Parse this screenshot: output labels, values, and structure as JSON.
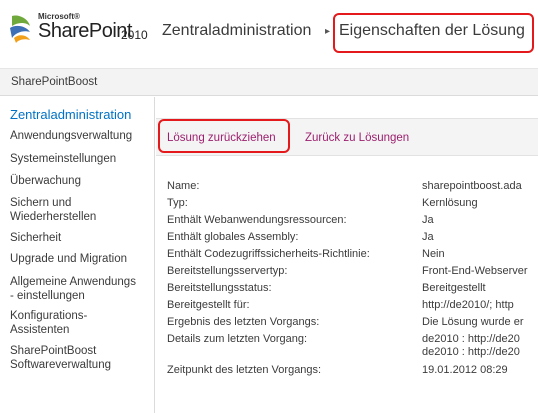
{
  "logo": {
    "microsoft": "Microsoft®",
    "product": "SharePoint",
    "version": "2010"
  },
  "breadcrumb": {
    "root": "Zentraladministration",
    "separator": "▸",
    "current": "Eigenschaften der Lösung"
  },
  "topnav": {
    "site": "SharePointBoost"
  },
  "leftnav": {
    "title": "Zentraladministration",
    "items": [
      "Anwendungsverwaltung",
      "Systemeinstellungen",
      "Überwachung",
      "Sichern und\nWiederherstellen",
      "Sicherheit",
      "Upgrade und Migration",
      "Allgemeine Anwendungs\n- einstellungen",
      "Konfigurations-\nAssistenten",
      "SharePointBoost\nSoftwareverwaltung"
    ]
  },
  "toolbar": {
    "withdraw": "Lösung zurückziehen",
    "back": "Zurück zu Lösungen"
  },
  "properties": [
    {
      "label": "Name:",
      "value": "sharepointboost.ada"
    },
    {
      "label": "Typ:",
      "value": "Kernlösung"
    },
    {
      "label": "Enthält Webanwendungsressourcen:",
      "value": "Ja"
    },
    {
      "label": "Enthält globales Assembly:",
      "value": "Ja"
    },
    {
      "label": "Enthält Codezugriffssicherheits-Richtlinie:",
      "value": "Nein"
    },
    {
      "label": "Bereitstellungsservertyp:",
      "value": "Front-End-Webserver"
    },
    {
      "label": "Bereitstellungsstatus:",
      "value": "Bereitgestellt"
    },
    {
      "label": "Bereitgestellt für:",
      "value": "http://de2010/; http"
    },
    {
      "label": "Ergebnis des letzten Vorgangs:",
      "value": "Die Lösung wurde er"
    },
    {
      "label": "Details zum letzten Vorgang:",
      "value": "de2010 : http://de20"
    },
    {
      "label": "",
      "value": "de2010 : http://de20"
    },
    {
      "label": "Zeitpunkt des letzten Vorgangs:",
      "value": "19.01.2012 08:29"
    }
  ],
  "colors": {
    "accent": "#0072c6",
    "link": "#9c1f6e",
    "highlight": "#e3191b"
  }
}
